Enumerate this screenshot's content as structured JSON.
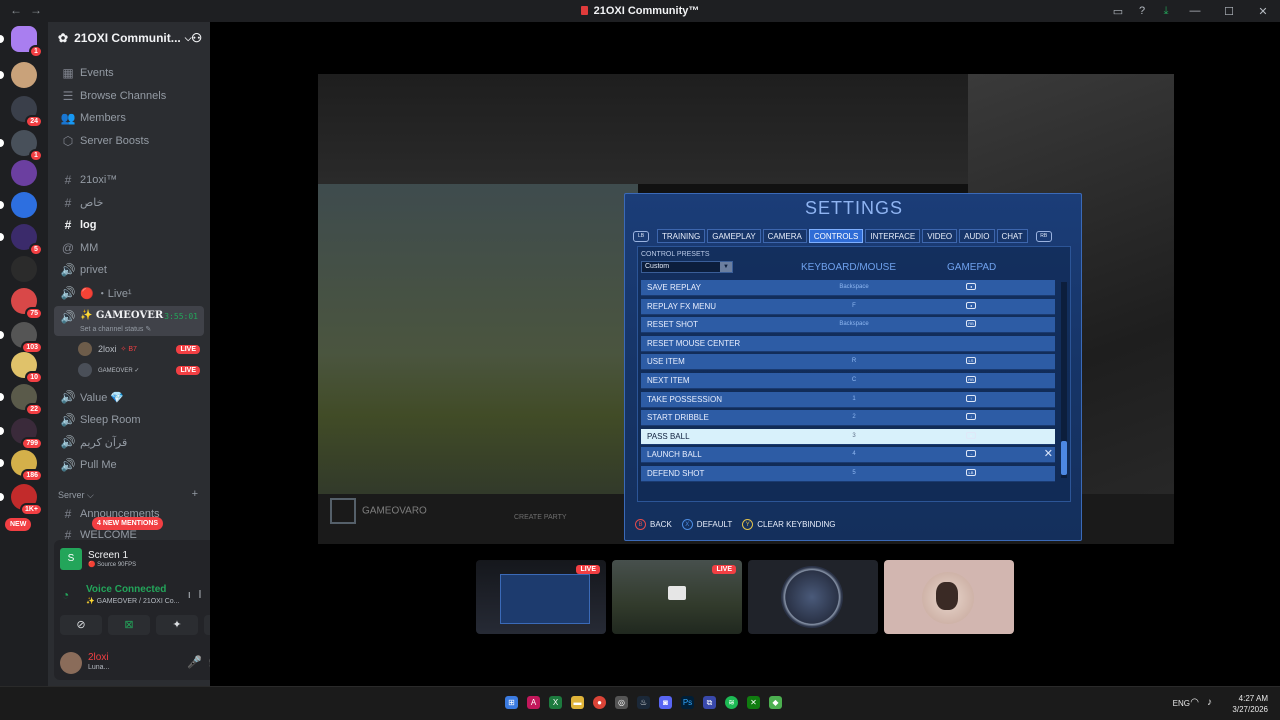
{
  "window": {
    "title": "21OXI Community™"
  },
  "server": {
    "name": "21OXI Communit..."
  },
  "menu": [
    {
      "label": "Events",
      "icon": "calendar-icon"
    },
    {
      "label": "Browse Channels",
      "icon": "browse-icon"
    },
    {
      "label": "Members",
      "icon": "members-icon"
    },
    {
      "label": "Server Boosts",
      "icon": "boost-icon"
    }
  ],
  "channels": [
    {
      "label": "21oxi™",
      "icon": "#"
    },
    {
      "label": "خاص",
      "icon": "#"
    },
    {
      "label": "log",
      "icon": "#",
      "bright": true
    },
    {
      "label": "MM",
      "icon": "@"
    },
    {
      "label": "privet",
      "icon": "🔊"
    },
    {
      "label": "🔴 ・Live¹",
      "icon": "🔊"
    }
  ],
  "voice_channel": {
    "name": "✨ GAMEOVER",
    "timer": "3:55:01",
    "status": "Set a channel status ✎",
    "users": [
      {
        "name": "2loxi",
        "extra": "✧ B7",
        "live": "LIVE"
      },
      {
        "name": "GAMEOVER ✓",
        "live": "LIVE"
      }
    ]
  },
  "channels_after": [
    {
      "label": "Value 💎",
      "icon": "🔊"
    },
    {
      "label": "Sleep Room",
      "icon": "🔊"
    },
    {
      "label": "قرآن كريم",
      "icon": "🔊"
    },
    {
      "label": "Pull Me",
      "icon": "🔊"
    }
  ],
  "category": {
    "label": "Server ⌵",
    "first": "Announcements",
    "second": "WELCOME"
  },
  "mentions": "4 NEW MENTIONS",
  "new_badge": "NEW",
  "servers": [
    {
      "badge": "1",
      "color": "#a97ef0"
    },
    {
      "badge": "",
      "color": "#c9a27a"
    },
    {
      "badge": "24",
      "color": "#3a3f4a"
    },
    {
      "badge": "1",
      "color": "#48505a"
    },
    {
      "badge": "",
      "color": "#6b3fa0"
    },
    {
      "badge": "",
      "color": "#2d6fe0"
    },
    {
      "badge": "5",
      "color": "#3b2b6b"
    },
    {
      "badge": "",
      "color": "#2b2b2b"
    },
    {
      "badge": "75",
      "color": "#d94848"
    },
    {
      "badge": "103",
      "color": "#555555"
    },
    {
      "badge": "10",
      "color": "#e0c26a"
    },
    {
      "badge": "22",
      "color": "#5a5a4a"
    },
    {
      "badge": "799",
      "color": "#3a2a3a"
    },
    {
      "badge": "186",
      "color": "#d4b04a"
    },
    {
      "badge": "1K+",
      "color": "#c22b2b"
    }
  ],
  "stream": {
    "title": "Screen 1",
    "sub": "🔴 Source 90FPS"
  },
  "voice": {
    "status": "Voice Connected",
    "location": "✨ GAMEOVER / 21OXI Co..."
  },
  "user": {
    "name": "2loxi",
    "status": "Luna..."
  },
  "game_settings": {
    "title": "SETTINGS",
    "tabs": [
      "TRAINING",
      "GAMEPLAY",
      "CAMERA",
      "CONTROLS",
      "INTERFACE",
      "VIDEO",
      "AUDIO",
      "CHAT"
    ],
    "lb": "LB",
    "rb": "RB",
    "presets_label": "CONTROL PRESETS",
    "preset_value": "Custom",
    "col_keyboard": "KEYBOARD/MOUSE",
    "col_gamepad": "GAMEPAD",
    "rows": [
      {
        "label": "SAVE REPLAY",
        "kb": "Backspace",
        "gp": "◂"
      },
      {
        "label": "REPLAY FX MENU",
        "kb": "F",
        "gp": "◂"
      },
      {
        "label": "RESET SHOT",
        "kb": "Backspace",
        "gp": "RB"
      },
      {
        "label": "RESET MOUSE CENTER",
        "kb": "",
        "gp": ""
      },
      {
        "label": "USE ITEM",
        "kb": "R",
        "gp": "LS"
      },
      {
        "label": "NEXT ITEM",
        "kb": "C",
        "gp": "RB"
      },
      {
        "label": "TAKE POSSESSION",
        "kb": "1",
        "gp": "↑"
      },
      {
        "label": "START DRIBBLE",
        "kb": "2",
        "gp": "↓"
      },
      {
        "label": "PASS BALL",
        "kb": "3",
        "gp": "●",
        "selected": true
      },
      {
        "label": "LAUNCH BALL",
        "kb": "4",
        "gp": "→"
      },
      {
        "label": "DEFEND SHOT",
        "kb": "5",
        "gp": "LB"
      }
    ],
    "hints": [
      {
        "key": "B",
        "label": "BACK"
      },
      {
        "key": "X",
        "label": "DEFAULT"
      },
      {
        "key": "Y",
        "label": "CLEAR KEYBINDING"
      }
    ]
  },
  "game_overlay": {
    "player": "GAMEOVARO",
    "party": "CREATE PARTY"
  },
  "tiles": [
    {
      "live": "LIVE"
    },
    {
      "live": "LIVE"
    }
  ],
  "taskbar": {
    "lang": "ENG",
    "time": "4:27 AM",
    "date": "3/27/2026"
  }
}
